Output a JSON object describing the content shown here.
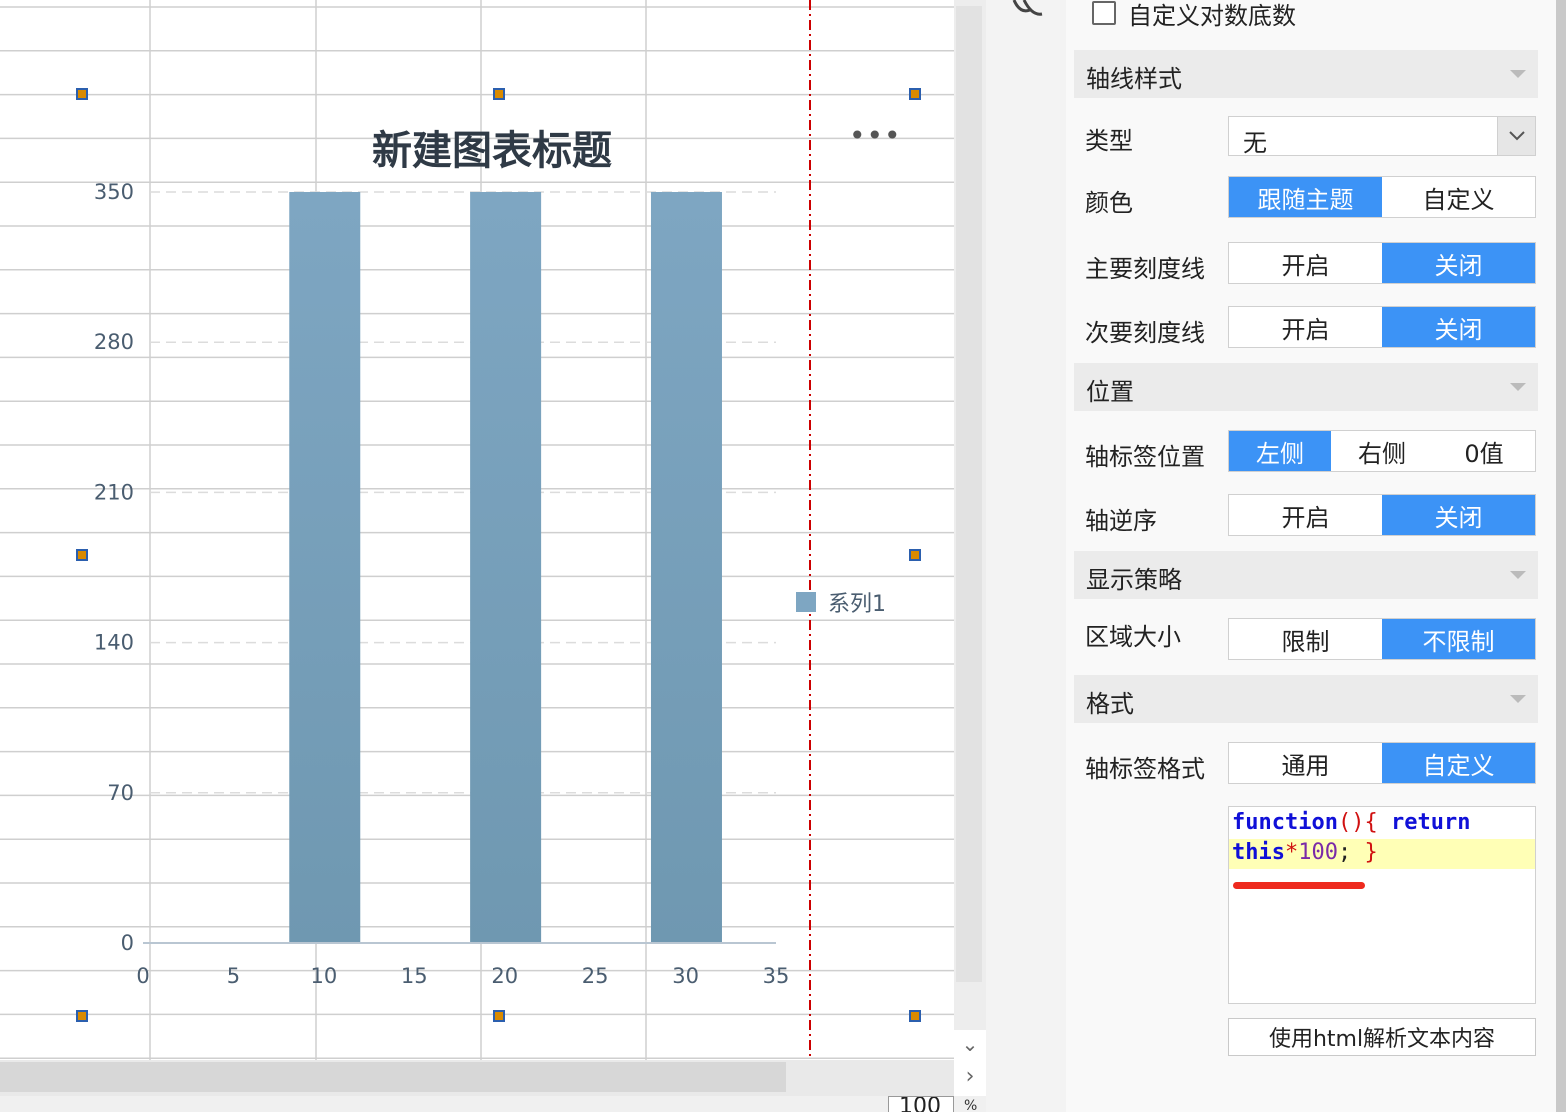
{
  "chart_data": {
    "type": "bar",
    "title": "新建图表标题",
    "x": [
      10,
      20,
      30
    ],
    "series": [
      {
        "name": "系列1",
        "values": [
          350,
          350,
          350
        ]
      }
    ],
    "xlim": [
      0,
      35
    ],
    "ylim": [
      0,
      350
    ],
    "xticks": [
      "0",
      "5",
      "10",
      "15",
      "20",
      "25",
      "30",
      "35"
    ],
    "yticks": [
      "0",
      "70",
      "140",
      "210",
      "280",
      "350"
    ],
    "legend_position": "right",
    "bar_color": "#7ea6c2",
    "grid": true
  },
  "canvas": {
    "more_icon": "ellipsis-icon",
    "zoom_value": "100",
    "zoom_unit": "%",
    "handle_color": "#d98a00",
    "guide_color": "#cc0000"
  },
  "panel": {
    "custom_log_base_label": "自定义对数底数",
    "sections": {
      "axis_style": "轴线样式",
      "position": "位置",
      "display_strategy": "显示策略",
      "format": "格式"
    },
    "type": {
      "label": "类型",
      "value": "无"
    },
    "color": {
      "label": "颜色",
      "options": [
        "跟随主题",
        "自定义"
      ],
      "active": 0
    },
    "major_tick": {
      "label": "主要刻度线",
      "options": [
        "开启",
        "关闭"
      ],
      "active": 1
    },
    "minor_tick": {
      "label": "次要刻度线",
      "options": [
        "开启",
        "关闭"
      ],
      "active": 1
    },
    "label_position": {
      "label": "轴标签位置",
      "options": [
        "左侧",
        "右侧",
        "0值"
      ],
      "active": 0
    },
    "axis_reverse": {
      "label": "轴逆序",
      "options": [
        "开启",
        "关闭"
      ],
      "active": 1
    },
    "area_size": {
      "label": "区域大小",
      "options": [
        "限制",
        "不限制"
      ],
      "active": 1
    },
    "label_format": {
      "label": "轴标签格式",
      "options": [
        "通用",
        "自定义"
      ],
      "active": 1
    },
    "code": {
      "kw_function": "function",
      "paren": "(){",
      "kw_return": "return",
      "kw_this": "this",
      "op": "*",
      "num": "100",
      "semi": ";",
      "close": "}"
    },
    "html_parse_button": "使用html解析文本内容",
    "accent_color": "#3c93f6"
  }
}
